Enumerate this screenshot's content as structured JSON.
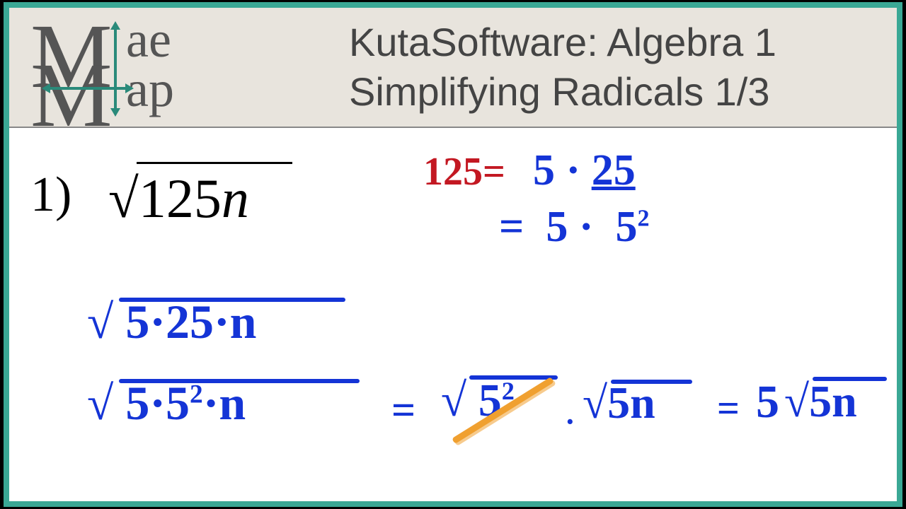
{
  "header": {
    "logo_ae": "ae",
    "logo_ap": "ap",
    "title_line1": "KutaSoftware: Algebra 1",
    "title_line2": "Simplifying Radicals 1/3"
  },
  "problem": {
    "number": "1)",
    "expression_radicand": "125",
    "expression_var": "n",
    "radical_sym": "√"
  },
  "work": {
    "factor_line1_lhs": "125",
    "factor_line1_eq": "=",
    "factor_line1_rhs_a": "5",
    "factor_line1_rhs_dot": "·",
    "factor_line1_rhs_b": "25",
    "factor_line2_eq": "=",
    "factor_line2_a": "5",
    "factor_line2_dot": "·",
    "factor_line2_b": "5",
    "factor_line2_exp": "2",
    "step1_radicand": "5·25·n",
    "step2_a": "5·5",
    "step2_exp": "2",
    "step2_b": "·n",
    "eq": "=",
    "mid_rad": "5",
    "mid_exp": "2",
    "mid_dot": "·",
    "mid_rad2": "5n",
    "final_coef": "5",
    "final_rad": "5n"
  }
}
